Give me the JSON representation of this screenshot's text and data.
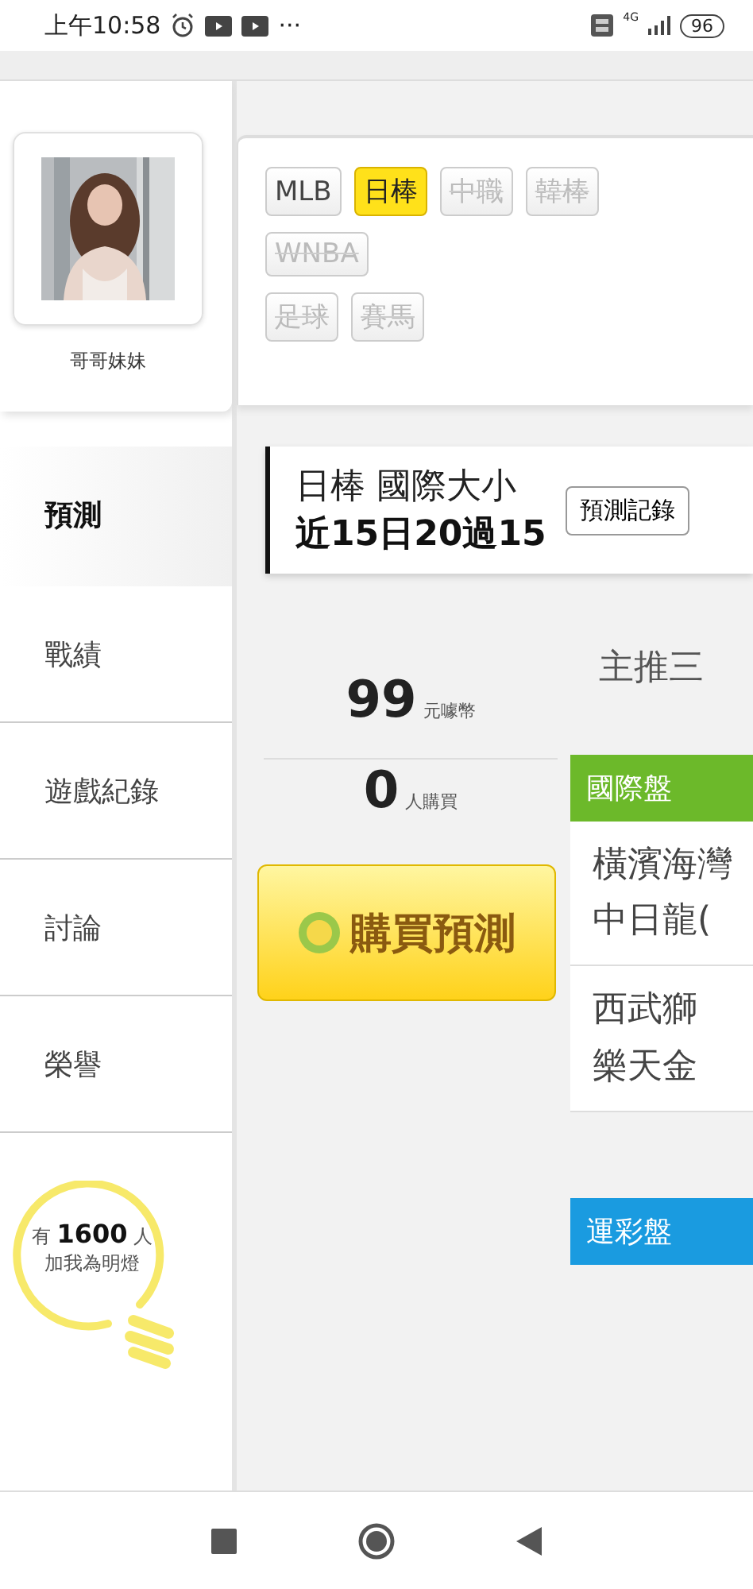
{
  "status_bar": {
    "time": "上午10:58",
    "more": "···",
    "network": "4G",
    "battery": "96"
  },
  "profile": {
    "name": "哥哥妹妹"
  },
  "sidebar": {
    "items": [
      {
        "label": "預測",
        "selected": true
      },
      {
        "label": "戰績",
        "selected": false
      },
      {
        "label": "遊戲紀錄",
        "selected": false
      },
      {
        "label": "討論",
        "selected": false
      },
      {
        "label": "榮譽",
        "selected": false
      }
    ]
  },
  "fans": {
    "prefix": "有",
    "count": "1600",
    "suffix": "人",
    "caption": "加我為明燈"
  },
  "league_tabs": [
    [
      {
        "label": "MLB",
        "selected": false,
        "disabled": false
      },
      {
        "label": "日棒",
        "selected": true,
        "disabled": false
      },
      {
        "label": "中職",
        "selected": false,
        "disabled": true
      },
      {
        "label": "韓棒",
        "selected": false,
        "disabled": true
      }
    ],
    [
      {
        "label": "WNBA",
        "selected": false,
        "disabled": true
      }
    ],
    [
      {
        "label": "足球",
        "selected": false,
        "disabled": true
      },
      {
        "label": "賽馬",
        "selected": false,
        "disabled": true
      }
    ]
  ],
  "prediction": {
    "title": "日棒 國際大小",
    "record": "近15日20過15",
    "record_button": "預測記錄"
  },
  "purchase": {
    "price": "99",
    "price_unit": "元噱幣",
    "buyers": "0",
    "buyers_unit": "人購買",
    "buy_button": "購買預測"
  },
  "picks": {
    "heading": "主推三",
    "sections": [
      {
        "title": "國際盤",
        "color": "#6cb92a",
        "games": [
          [
            "橫濱海灣",
            "中日龍("
          ],
          [
            "西武獅",
            "樂天金"
          ]
        ]
      },
      {
        "title": "運彩盤",
        "color": "#1a9be0"
      }
    ]
  }
}
